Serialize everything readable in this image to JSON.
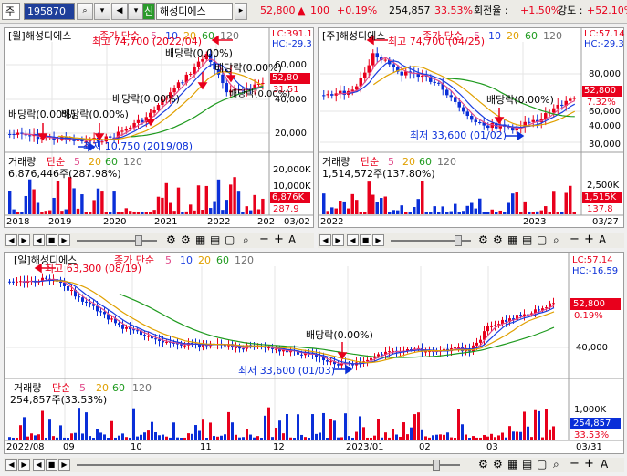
{
  "toolbar": {
    "market_label": "주",
    "code": "195870",
    "sin_badge": "신",
    "stock_name": "해성디에스",
    "price": "52,800",
    "change_arrow": "▲",
    "change": "100",
    "change_rate": "+0.19%",
    "volume": "254,857",
    "volume_ratio": "33.53%",
    "turnover_label": "회전율 :",
    "turnover": "+1.50%",
    "strength_label": "강도 :",
    "strength": "+52.10%"
  },
  "monthly": {
    "title": "[월]해성디에스",
    "ma_label": "종가 단순",
    "ma_periods": [
      "5",
      "10",
      "20",
      "60",
      "120"
    ],
    "lc": "LC:391.1",
    "hc": "HC:-29.3",
    "price_ticks": [
      "60,000",
      "40,000",
      "20,000"
    ],
    "price_box": "52,80",
    "rate_box": "31.51",
    "high_label": "최고 74,700 (2022/04)",
    "low_label": "최저 10,750 (2019/08)",
    "dividend_labels": [
      "배당락(0.00%)",
      "배당락(0.00%)",
      "배당락(0.00%)",
      "배당락(0.00%)",
      "배당락(0.00%)",
      "배당락(0.00%)"
    ],
    "vol_title": "거래량",
    "vol_ma_label": "단순",
    "vol_ma_periods": [
      "5",
      "20",
      "60",
      "120"
    ],
    "vol_value": "6,876,446주(287.98%)",
    "vol_ticks": [
      "20,000K",
      "10,000K"
    ],
    "vol_box": "6,876K",
    "vol_rate_box": "287.9",
    "x_ticks": [
      "2018",
      "2019",
      "2020",
      "2021",
      "2022",
      "202"
    ],
    "date": "03/02"
  },
  "weekly": {
    "title": "[주]해성디에스",
    "ma_label": "종가 단순",
    "ma_periods": [
      "5",
      "10",
      "20",
      "60",
      "120"
    ],
    "lc": "LC:57.14",
    "hc": "HC:-29.3",
    "price_ticks": [
      "80,000",
      "60,000",
      "40,000",
      "30,000"
    ],
    "price_box": "52,800",
    "rate_box": "7.32%",
    "high_label": "최고 74,700 (04/25)",
    "low_label": "최저 33,600 (01/02)",
    "dividend_label": "배당락(0.00%)",
    "vol_title": "거래량",
    "vol_ma_label": "단순",
    "vol_ma_periods": [
      "5",
      "20",
      "60",
      "120"
    ],
    "vol_value": "1,514,572주(137.80%)",
    "vol_ticks": [
      "2,500K",
      "1,000K"
    ],
    "vol_box": "1,515K",
    "vol_rate_box": "137.8",
    "x_ticks": [
      "2022",
      "2023"
    ],
    "date": "03/27"
  },
  "daily": {
    "title": "[일]해성디에스",
    "ma_label": "종가 단순",
    "ma_periods": [
      "5",
      "10",
      "20",
      "60",
      "120"
    ],
    "lc": "LC:57.14",
    "hc": "HC:-16.59",
    "price_ticks": [
      "40,000"
    ],
    "price_box": "52,800",
    "rate_label": "0.19%",
    "high_label": "최고 63,300 (08/19)",
    "low_label": "최저 33,600 (01/03)",
    "dividend_label": "배당락(0.00%)",
    "vol_title": "거래량",
    "vol_ma_label": "단순",
    "vol_ma_periods": [
      "5",
      "20",
      "60",
      "120"
    ],
    "vol_value": "254,857주(33.53%)",
    "vol_ticks": [
      "1,000K",
      "500K"
    ],
    "vol_box": "254,857",
    "vol_rate_box": "33.53%",
    "x_ticks": [
      "2022/08",
      "09",
      "10",
      "11",
      "12",
      "2023/01",
      "02",
      "03"
    ],
    "date": "03/31"
  },
  "controls": {
    "buttons": [
      "◀",
      "▶",
      "◀",
      "■",
      "▶"
    ],
    "zoom_minus": "−",
    "zoom_plus": "+",
    "font_a": "A"
  },
  "colors": {
    "up": "#e8001c",
    "down": "#0a2fd8",
    "ma5": "#e04a8a",
    "ma10": "#1a3ee0",
    "ma20": "#e0a000",
    "ma60": "#1e9a1e",
    "ma120": "#707070"
  }
}
